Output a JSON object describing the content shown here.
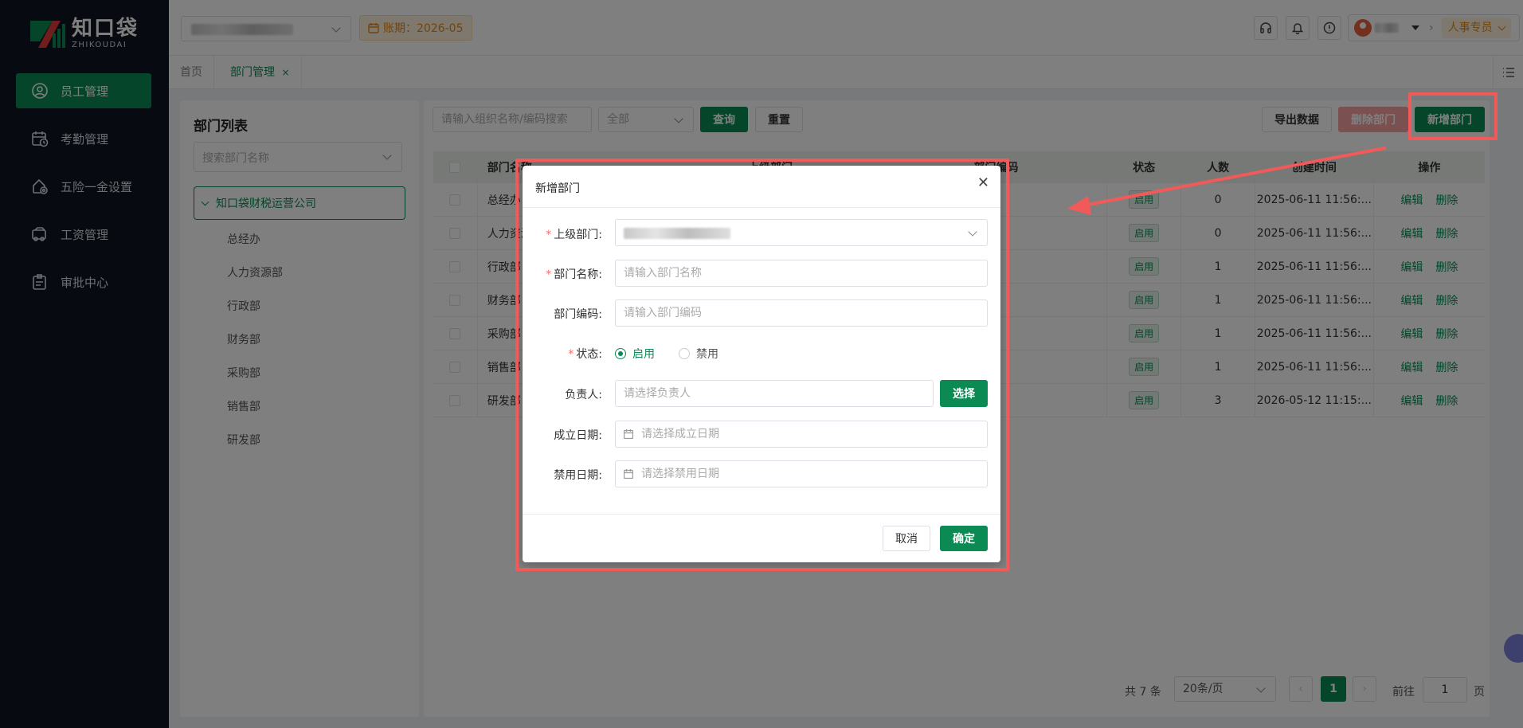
{
  "brand": {
    "name_cn": "知口袋",
    "name_en": "ZHIKOUDAI"
  },
  "sidebar": {
    "items": [
      {
        "label": "员工管理",
        "icon": "user-circle-icon",
        "active": true
      },
      {
        "label": "考勤管理",
        "icon": "calendar-clock-icon",
        "active": false
      },
      {
        "label": "五险一金设置",
        "icon": "shield-gear-icon",
        "active": false
      },
      {
        "label": "工资管理",
        "icon": "money-card-icon",
        "active": false
      },
      {
        "label": "审批中心",
        "icon": "clipboard-icon",
        "active": false
      }
    ]
  },
  "header": {
    "period": "账期：2026-05",
    "role": "人事专员"
  },
  "tabs": {
    "home": "首页",
    "current": "部门管理",
    "close": "×"
  },
  "left_panel": {
    "title": "部门列表",
    "search_placeholder": "搜索部门名称",
    "root": "知口袋财税运营公司",
    "children": [
      "总经办",
      "人力资源部",
      "行政部",
      "财务部",
      "采购部",
      "销售部",
      "研发部"
    ]
  },
  "toolbar": {
    "search_placeholder": "请输入组织名称/编码搜索",
    "status_select": "全部",
    "query": "查询",
    "reset": "重置",
    "export": "导出数据",
    "delete": "删除部门",
    "add": "新增部门"
  },
  "table": {
    "headers": [
      "部门名称",
      "上级部门",
      "部门编码",
      "状态",
      "人数",
      "创建时间",
      "操作"
    ],
    "rows": [
      {
        "name": "总经办",
        "status": "启用",
        "count": "0",
        "created": "2025-06-11 11:56:..."
      },
      {
        "name": "人力资源部",
        "status": "启用",
        "count": "0",
        "created": "2025-06-11 11:56:..."
      },
      {
        "name": "行政部",
        "status": "启用",
        "count": "1",
        "created": "2025-06-11 11:56:..."
      },
      {
        "name": "财务部",
        "status": "启用",
        "count": "1",
        "created": "2025-06-11 11:56:..."
      },
      {
        "name": "采购部",
        "status": "启用",
        "count": "1",
        "created": "2025-06-11 11:56:..."
      },
      {
        "name": "销售部",
        "status": "启用",
        "count": "1",
        "created": "2025-06-11 11:56:..."
      },
      {
        "name": "研发部",
        "status": "启用",
        "count": "3",
        "created": "2026-05-12 11:15:..."
      }
    ],
    "op_edit": "编辑",
    "op_delete": "删除"
  },
  "pagination": {
    "total": "共 7 条",
    "page_size": "20条/页",
    "current": "1",
    "goto_prefix": "前往",
    "goto_value": "1",
    "goto_suffix": "页"
  },
  "dialog": {
    "title": "新增部门",
    "fields": {
      "parent": {
        "label": "上级部门:"
      },
      "name": {
        "label": "部门名称:",
        "placeholder": "请输入部门名称"
      },
      "code": {
        "label": "部门编码:",
        "placeholder": "请输入部门编码"
      },
      "status": {
        "label": "状态:",
        "option_on": "启用",
        "option_off": "禁用",
        "selected": "启用"
      },
      "manager": {
        "label": "负责人:",
        "placeholder": "请选择负责人",
        "button": "选择"
      },
      "founded": {
        "label": "成立日期:",
        "placeholder": "请选择成立日期"
      },
      "disabled": {
        "label": "禁用日期:",
        "placeholder": "请选择禁用日期"
      }
    },
    "cancel": "取消",
    "confirm": "确定"
  },
  "colors": {
    "primary": "#0b8a54",
    "sidebar_bg": "#0f1520",
    "annotation": "#f25a5a",
    "warning": "#e08a18"
  }
}
